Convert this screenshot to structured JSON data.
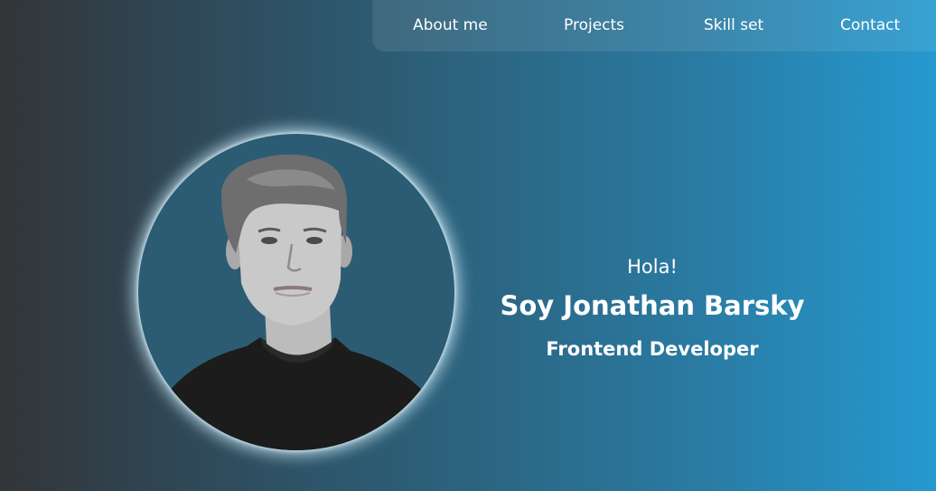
{
  "nav": {
    "items": [
      {
        "label": "About me"
      },
      {
        "label": "Projects"
      },
      {
        "label": "Skill set"
      },
      {
        "label": "Contact"
      }
    ]
  },
  "hero": {
    "greeting": "Hola!",
    "name": "Soy Jonathan Barsky",
    "role": "Frontend Developer",
    "avatar_icon": "profile-photo"
  },
  "colors": {
    "gradient_start": "#333538",
    "gradient_end": "#2599cf",
    "avatar_bg": "#2b5c73",
    "avatar_glow": "#c8e8f5",
    "text": "#ffffff"
  }
}
